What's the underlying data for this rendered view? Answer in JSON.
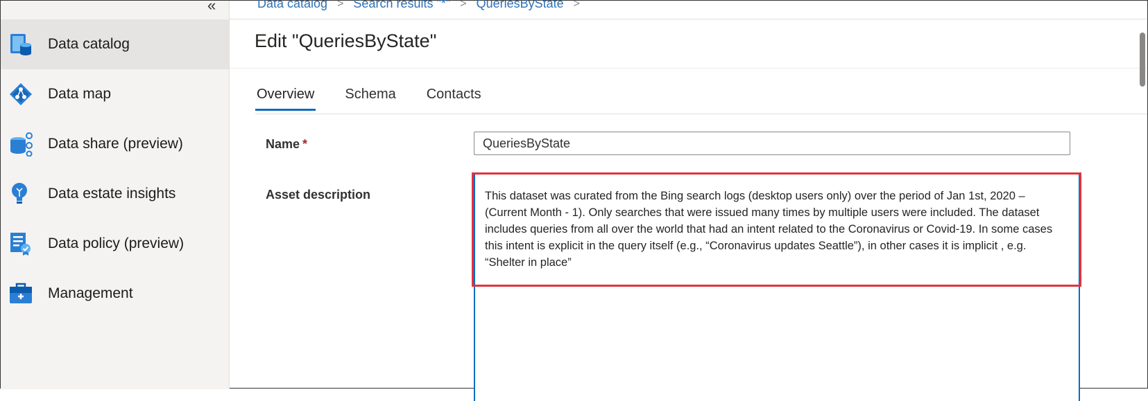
{
  "sidebar": {
    "collapse_glyph": "«",
    "items": [
      {
        "label": "Data catalog",
        "icon": "data-catalog-icon"
      },
      {
        "label": "Data map",
        "icon": "data-map-icon"
      },
      {
        "label": "Data share (preview)",
        "icon": "data-share-icon"
      },
      {
        "label": "Data estate insights",
        "icon": "insights-icon"
      },
      {
        "label": "Data policy (preview)",
        "icon": "data-policy-icon"
      },
      {
        "label": "Management",
        "icon": "management-icon"
      }
    ]
  },
  "breadcrumb": {
    "items": [
      "Data catalog",
      "Search results \"*\"",
      "QueriesByState"
    ],
    "separator": ">"
  },
  "page": {
    "title": "Edit \"QueriesByState\""
  },
  "tabs": [
    "Overview",
    "Schema",
    "Contacts"
  ],
  "form": {
    "name_label": "Name",
    "required_mark": "*",
    "name_value": "QueriesByState",
    "description_label": "Asset description",
    "description_value": "This dataset was curated from the Bing search logs (desktop users only) over the period of Jan 1st, 2020 – (Current Month - 1). Only searches that were issued many times by multiple users were included. The dataset includes queries from all over the world that had an intent related to the Coronavirus or Covid-19. In some cases this intent is explicit in the query itself (e.g., “Coronavirus updates Seattle”), in other cases it is implicit , e.g. “Shelter in place”"
  },
  "colors": {
    "accent": "#0f6cbd",
    "link": "#2e6fb6",
    "highlight": "#e0333f",
    "sidebar_bg": "#f4f3f2"
  }
}
